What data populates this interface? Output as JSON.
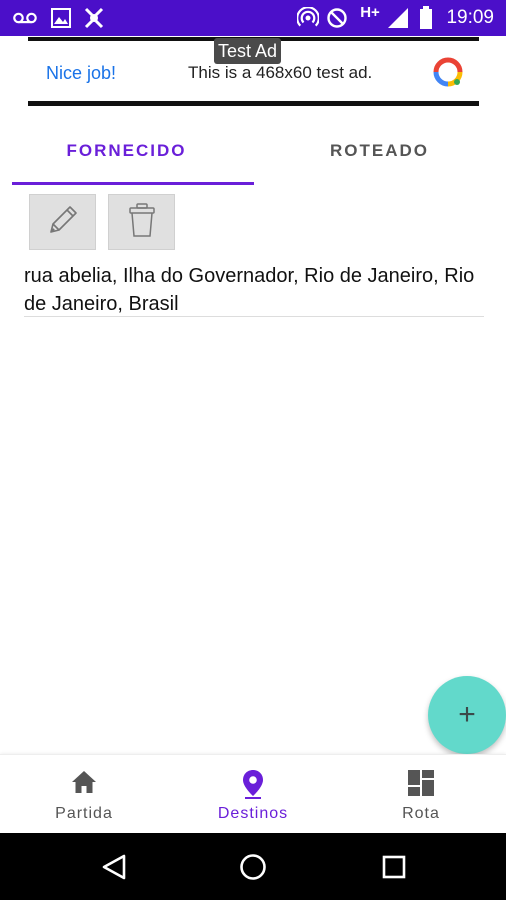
{
  "status_bar": {
    "time": "19:09",
    "network_label": "H+",
    "background": "#4b0fc9",
    "left_icons": [
      "voicemail-icon",
      "image-icon",
      "app-notification-icon"
    ],
    "right_icons": [
      "hotspot-icon",
      "do-not-disturb-icon",
      "signal-icon",
      "battery-icon"
    ]
  },
  "ad": {
    "label": "Test Ad",
    "nice": "Nice job!",
    "text": "This is a 468x60 test ad.",
    "nice_color": "#1a73e8"
  },
  "tabs": [
    {
      "label": "FORNECIDO",
      "selected": true
    },
    {
      "label": "ROTEADO",
      "selected": false
    }
  ],
  "accent_color": "#6a1fd9",
  "list": {
    "edit_icon": "pencil-icon",
    "delete_icon": "trash-icon",
    "address": "rua abelia, Ilha do Governador, Rio de Janeiro, Rio de Janeiro, Brasil"
  },
  "fab": {
    "icon": "plus-icon",
    "label": "+",
    "color": "#62d9cb"
  },
  "bottom_nav": [
    {
      "label": "Partida",
      "icon": "home-icon",
      "selected": false
    },
    {
      "label": "Destinos",
      "icon": "location-pin-icon",
      "selected": true
    },
    {
      "label": "Rota",
      "icon": "dashboard-icon",
      "selected": false
    }
  ],
  "system_nav": [
    "back-icon",
    "home-circle-icon",
    "recents-icon"
  ]
}
